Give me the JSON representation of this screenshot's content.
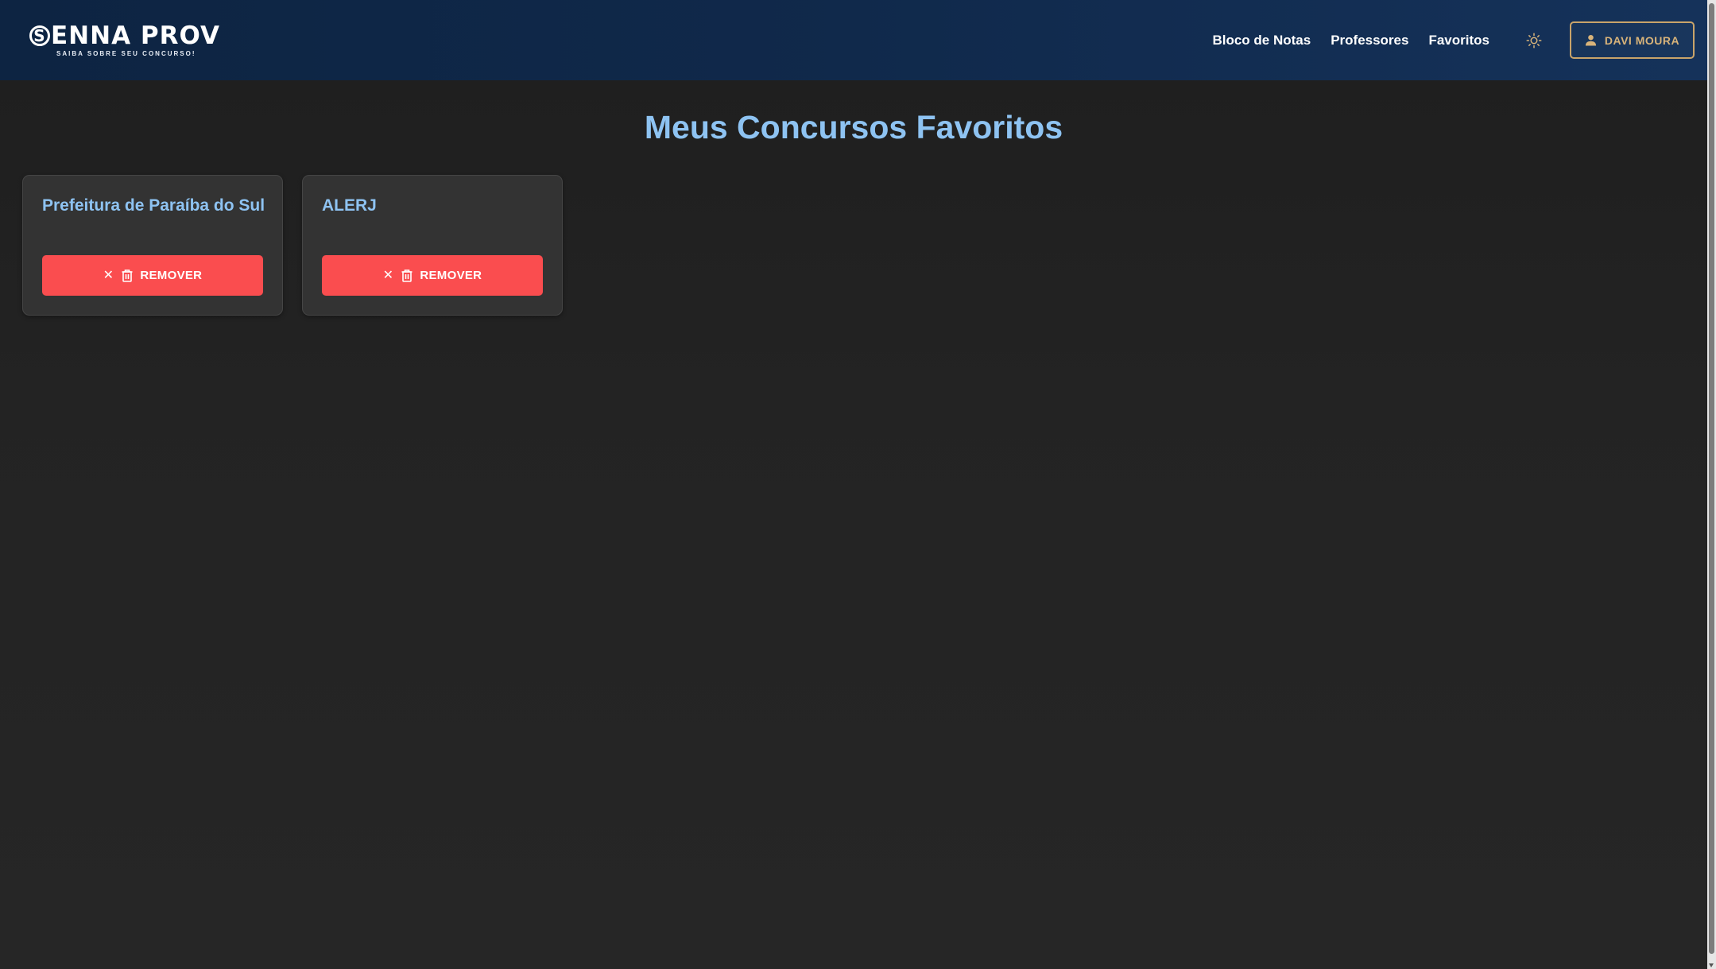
{
  "header": {
    "logo_main": "ENNA PROV",
    "logo_letter": "S",
    "logo_subtitle": "SAIBA SOBRE SEU CONCURSO!",
    "nav": [
      {
        "label": "Bloco de Notas"
      },
      {
        "label": "Professores"
      },
      {
        "label": "Favoritos"
      }
    ],
    "theme_icon": "sun-icon",
    "user_label": "DAVI MOURA",
    "user_icon": "user-icon"
  },
  "main": {
    "title": "Meus Concursos Favoritos",
    "cards": [
      {
        "title": "Prefeitura de Paraíba do Sul",
        "remove_label": "REMOVER"
      },
      {
        "title": "ALERJ",
        "remove_label": "REMOVER"
      }
    ]
  },
  "colors": {
    "header_bg": "#10294b",
    "accent_blue": "#8ec3f2",
    "remove_red": "#fa4d4f",
    "user_gold": "#c9a46a",
    "card_bg": "#333333",
    "page_bg": "#232323"
  }
}
